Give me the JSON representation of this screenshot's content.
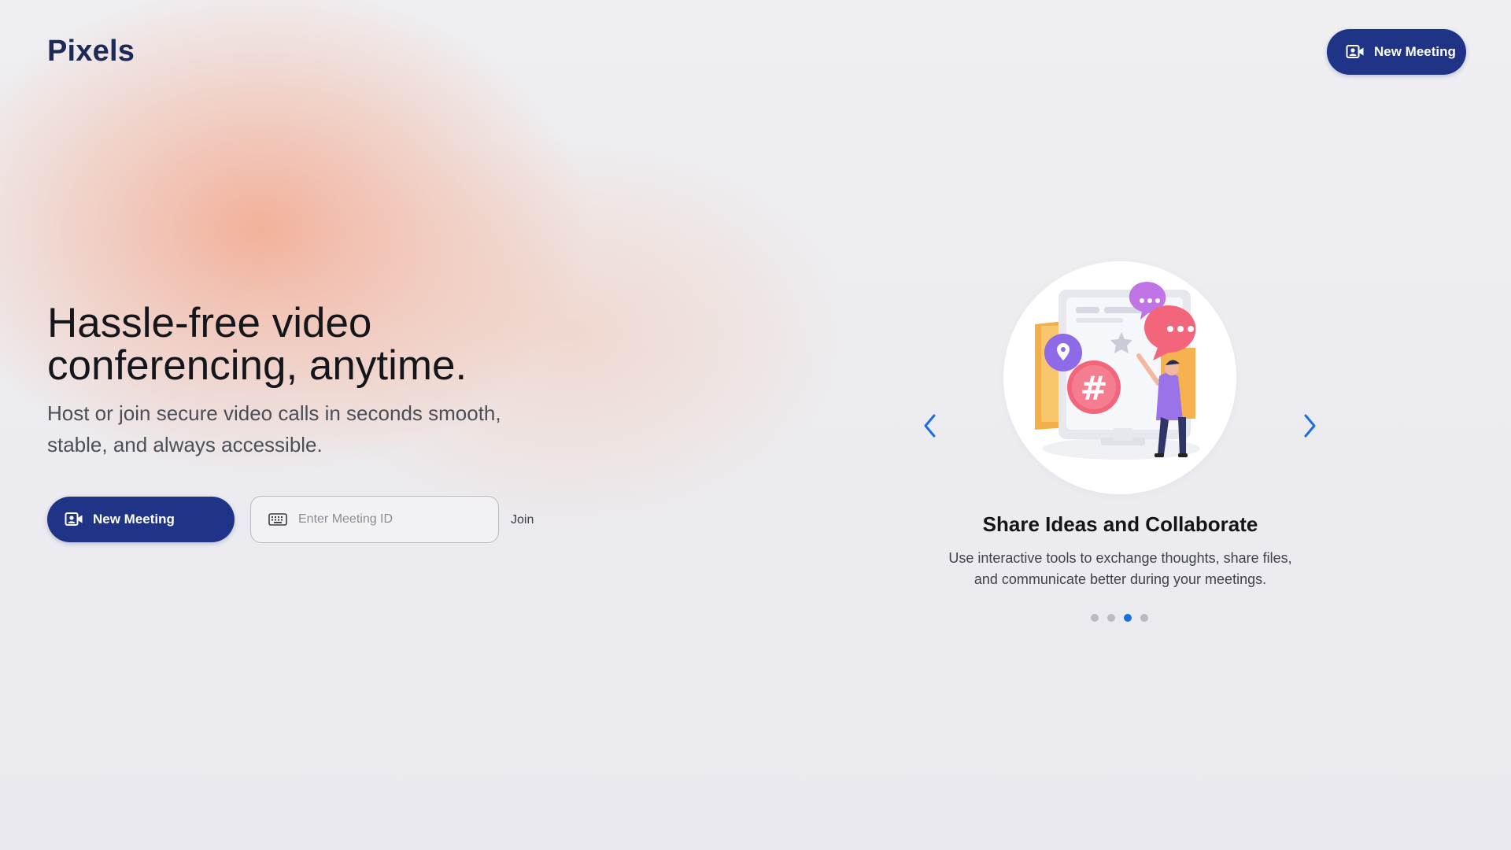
{
  "header": {
    "logo": "Pixels",
    "new_meeting_label": "New Meeting"
  },
  "hero": {
    "title_line1": "Hassle-free video",
    "title_line2": "conferencing, anytime.",
    "subtitle_line1": "Host or join secure video calls in seconds smooth,",
    "subtitle_line2": "stable, and always accessible.",
    "new_meeting_label": "New Meeting",
    "meeting_input_placeholder": "Enter Meeting ID",
    "meeting_input_value": "",
    "join_label": "Join"
  },
  "carousel": {
    "slide_title": "Share Ideas and Collaborate",
    "slide_desc_line1": "Use interactive tools to exchange thoughts, share files,",
    "slide_desc_line2": "and communicate better during your meetings.",
    "dot_count": 4,
    "active_index": 2,
    "illustration_icon": "collaboration-illustration",
    "prev_icon": "chevron-left-icon",
    "next_icon": "chevron-right-icon"
  },
  "colors": {
    "brand": "#1f3387",
    "logo": "#1d2a55",
    "accent_blue": "#1a6fe0",
    "bg_glow": "#f4a082"
  }
}
